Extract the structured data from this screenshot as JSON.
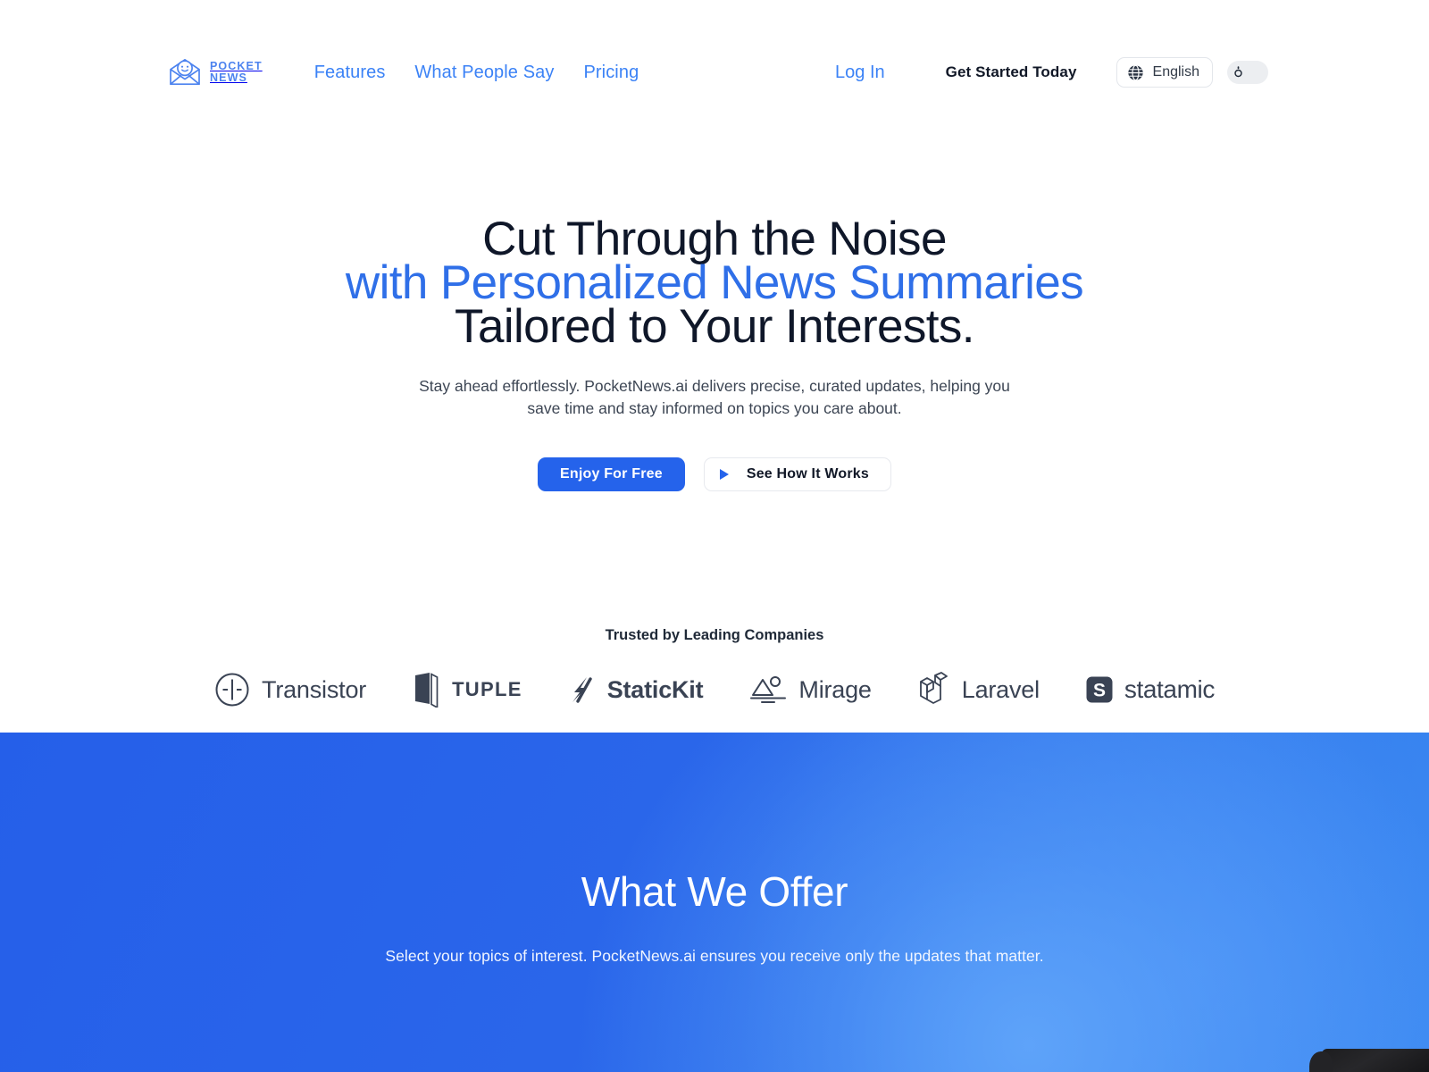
{
  "brand": {
    "line1": "POCKET",
    "line2": "NEWS",
    "icon": "envelope-smile-icon"
  },
  "nav": {
    "items": [
      {
        "label": "Features"
      },
      {
        "label": "What People Say"
      },
      {
        "label": "Pricing"
      }
    ],
    "login_label": "Log In",
    "cta_label": "Get Started Today"
  },
  "language": {
    "icon": "globe-icon",
    "selected": "English"
  },
  "theme": {
    "icon": "sun-icon",
    "state": "light"
  },
  "hero": {
    "title_line1": "Cut Through the Noise",
    "title_line2": "with Personalized News Summaries",
    "title_line3": "Tailored to Your Interests.",
    "subtitle_line1": "Stay ahead effortlessly. PocketNews.ai delivers precise, curated updates, helping you save",
    "subtitle_line2": "time and stay informed on topics you care about.",
    "primary_cta": "Enjoy For Free",
    "secondary_cta": "See How It Works",
    "secondary_icon": "play-icon"
  },
  "trusted": {
    "heading": "Trusted by Leading Companies",
    "logos": [
      {
        "name": "Transistor",
        "icon": "transistor-icon"
      },
      {
        "name": "TUPLE",
        "icon": "tuple-icon"
      },
      {
        "name": "StaticKit",
        "icon": "statickit-icon"
      },
      {
        "name": "Mirage",
        "icon": "mirage-icon"
      },
      {
        "name": "Laravel",
        "icon": "laravel-icon"
      },
      {
        "name": "statamic",
        "icon": "statamic-icon"
      }
    ]
  },
  "offer": {
    "title": "What We Offer",
    "subtitle": "Select your topics of interest. PocketNews.ai ensures you receive only the updates that matter."
  },
  "colors": {
    "brand_blue": "#3b82f6",
    "primary_button": "#2563eb",
    "heading_dark": "#0f1729",
    "accent_text": "#2f6fe8",
    "section_blue_start": "#255fe9",
    "section_blue_end": "#3585ee",
    "logo_gray": "#3a4354"
  }
}
